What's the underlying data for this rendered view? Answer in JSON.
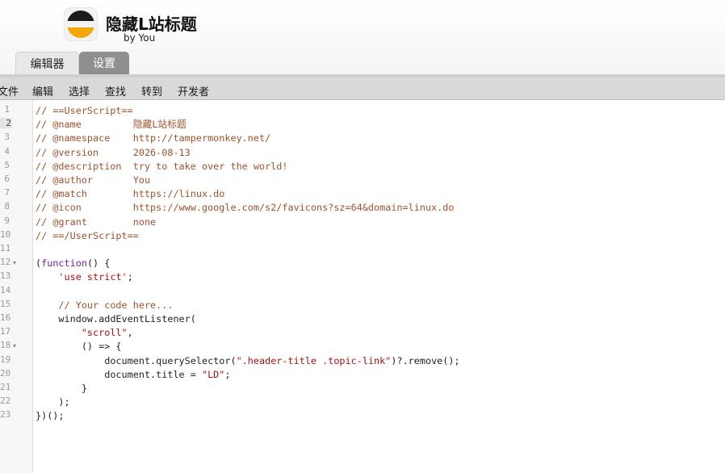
{
  "header": {
    "title": "隐藏L站标题",
    "author": "by You"
  },
  "tabs": [
    {
      "label": "编辑器"
    },
    {
      "label": "设置"
    }
  ],
  "menu": [
    "文件",
    "编辑",
    "选择",
    "查找",
    "转到",
    "开发者"
  ],
  "editor": {
    "active_line": 2,
    "line_numbers": [
      "1",
      "2",
      "3",
      "4",
      "5",
      "6",
      "7",
      "8",
      "9",
      "10",
      "11",
      "12",
      "13",
      "14",
      "15",
      "16",
      "17",
      "18",
      "19",
      "20",
      "21",
      "22",
      "23"
    ],
    "lines": [
      "// ==UserScript==",
      "// @name         隐藏L站标题",
      "// @namespace    http://tampermonkey.net/",
      "// @version      2026-08-13",
      "// @description  try to take over the world!",
      "// @author       You",
      "// @match        https://linux.do",
      "// @icon         https://www.google.com/s2/favicons?sz=64&domain=linux.do",
      "// @grant        none",
      "// ==/UserScript==",
      "",
      "(function() {",
      "    'use strict';",
      "",
      "    // Your code here...",
      "    window.addEventListener(",
      "        \"scroll\",",
      "        () => {",
      "            document.querySelector(\".header-title .topic-link\")?.remove();",
      "            document.title = \"LD\";",
      "        }",
      "    );",
      "})();"
    ]
  }
}
